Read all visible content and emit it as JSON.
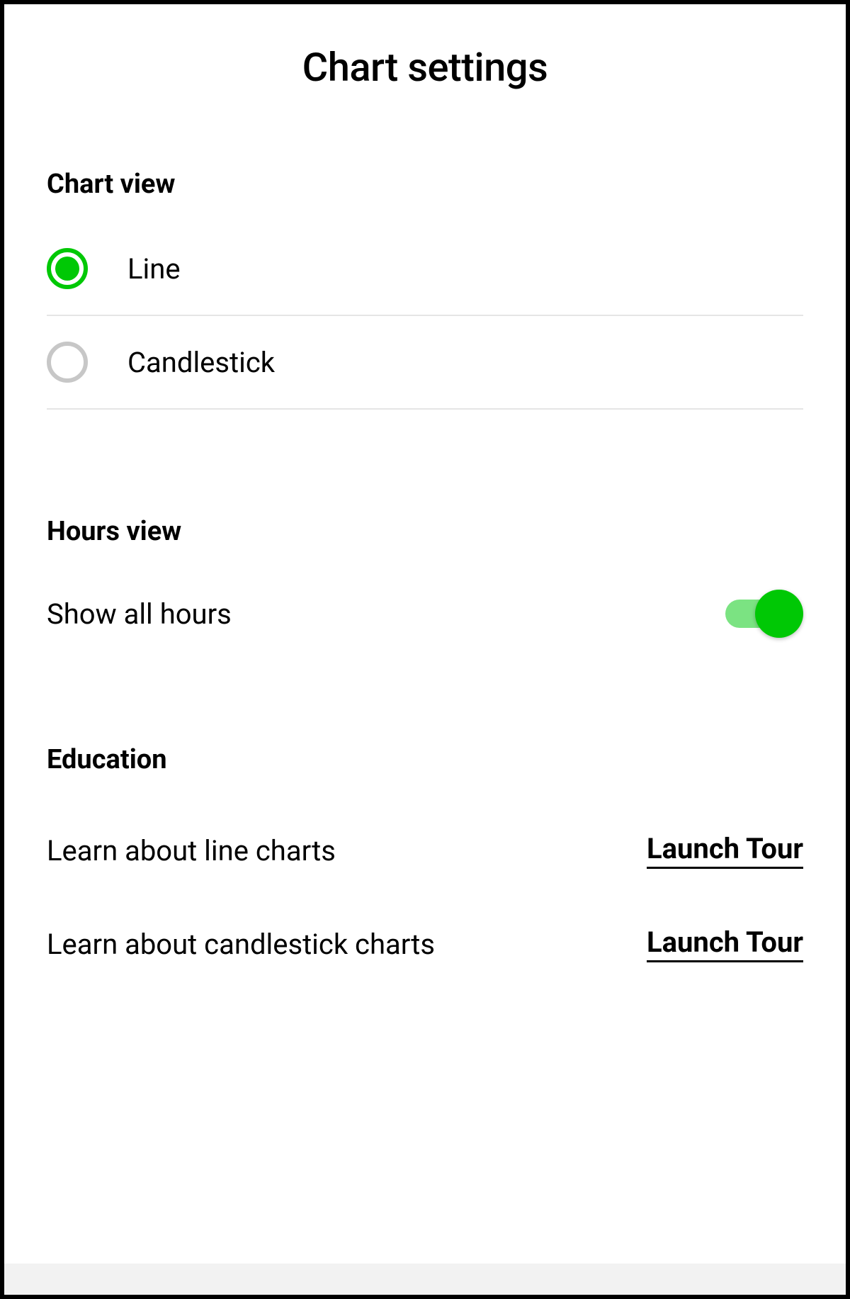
{
  "title": "Chart settings",
  "chart_view": {
    "heading": "Chart view",
    "options": [
      {
        "label": "Line",
        "selected": true
      },
      {
        "label": "Candlestick",
        "selected": false
      }
    ]
  },
  "hours_view": {
    "heading": "Hours view",
    "toggle_label": "Show all hours",
    "toggle_on": true
  },
  "education": {
    "heading": "Education",
    "items": [
      {
        "label": "Learn about line charts",
        "action": "Launch Tour"
      },
      {
        "label": "Learn about candlestick charts",
        "action": "Launch Tour"
      }
    ]
  },
  "colors": {
    "accent": "#00c805",
    "accent_light": "#7be382",
    "divider": "#e5e5e5",
    "radio_unselected": "#c7c7c7"
  }
}
